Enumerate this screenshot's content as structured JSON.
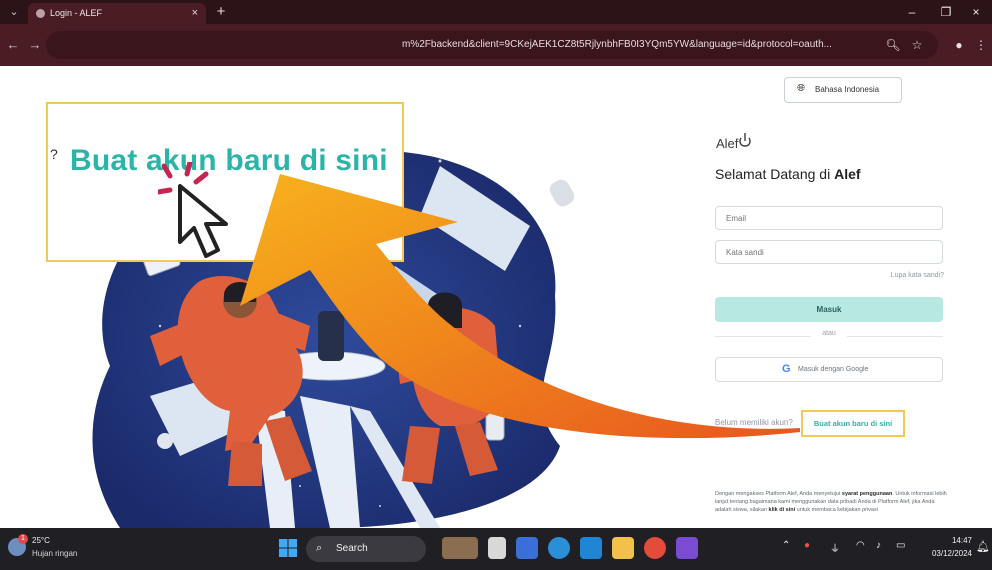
{
  "browser": {
    "tab_title": "Login - ALEF",
    "tab_close": "×",
    "new_tab": "+",
    "url": "m%2Fbackend&client=9CKejAEK1CZ8t5RjlynbhFB0I3YQm5YW&language=id&protocol=oauth...",
    "minimize": "–",
    "restore": "❐",
    "close": "×"
  },
  "zoom_callout": {
    "text": "Buat akun baru di sini"
  },
  "login": {
    "language": "Bahasa Indonesia",
    "logo": "Alef",
    "welcome_prefix": "Selamat Datang di ",
    "welcome_brand": "Alef",
    "email_placeholder": "Email",
    "password_placeholder": "Kata sandi",
    "forgot_password": "Lupa kata sandi?",
    "login_button": "Masuk",
    "or": "atau",
    "google_button": "Masuk dengan Google",
    "no_account": "Belum memiliki akun?",
    "create_account": "Buat akun baru di sini",
    "terms_1": "Dengan mengakses Platform Alef, Anda menyetujui ",
    "terms_link": "syarat penggunaan",
    "terms_2": ". Untuk informasi lebih lanjut tentang bagaimana kami menggunakan data pribadi Anda di Platform Alef, jika Anda adalah siswa, silakan ",
    "terms_link2": "klik di sini",
    "terms_3": " untuk membaca kebijakan privasi"
  },
  "taskbar": {
    "temp": "25°C",
    "weather": "Hujan ringan",
    "weather_badge": "1",
    "search": "Search",
    "time": "14:47",
    "date": "03/12/2024"
  },
  "colors": {
    "accent": "#2bb4a8",
    "highlight": "#f0c95a",
    "chrome": "#4a1c24"
  }
}
